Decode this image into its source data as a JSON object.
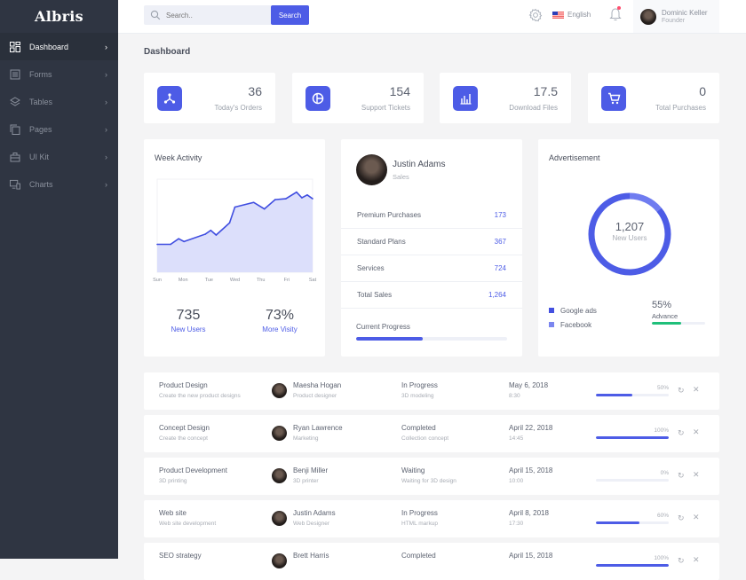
{
  "app": {
    "logo": "Albris"
  },
  "sidebar": {
    "items": [
      {
        "label": "Dashboard",
        "icon": "dashboard-grid-icon",
        "active": true
      },
      {
        "label": "Forms",
        "icon": "forms-icon"
      },
      {
        "label": "Tables",
        "icon": "layers-icon"
      },
      {
        "label": "Pages",
        "icon": "pages-copy-icon"
      },
      {
        "label": "UI Kit",
        "icon": "briefcase-icon"
      },
      {
        "label": "Charts",
        "icon": "monitor-chart-icon"
      }
    ]
  },
  "topbar": {
    "search_placeholder": "Search..",
    "search_button": "Search",
    "language": "English",
    "user": {
      "name": "Dominic Keller",
      "role": "Founder"
    }
  },
  "page": {
    "title": "Dashboard"
  },
  "stats": [
    {
      "value": "36",
      "label": "Today's Orders",
      "icon": "network-icon"
    },
    {
      "value": "154",
      "label": "Support Tickets",
      "icon": "pie-icon"
    },
    {
      "value": "17.5",
      "label": "Download Files",
      "icon": "bar-chart-icon"
    },
    {
      "value": "0",
      "label": "Total Purchases",
      "icon": "cart-icon"
    }
  ],
  "week_activity": {
    "title": "Week Activity",
    "new_users_value": "735",
    "new_users_label": "New Users",
    "visity_value": "73%",
    "visity_label": "More Visity"
  },
  "chart_data": {
    "type": "area",
    "title": "Week Activity",
    "categories": [
      "Sun",
      "Mon",
      "Tue",
      "Wed",
      "Thu",
      "Fri",
      "Sat"
    ],
    "x": [
      0,
      0.5,
      0.8,
      1.0,
      1.8,
      2.0,
      2.2,
      2.7,
      2.9,
      3.6,
      4.0,
      4.4,
      4.8,
      5.2,
      5.4,
      5.6,
      5.8
    ],
    "y": [
      30,
      30,
      36,
      33,
      41,
      45,
      40,
      53,
      70,
      75,
      68,
      78,
      79,
      86,
      80,
      83,
      79
    ],
    "ylim": [
      0,
      100
    ],
    "xlim": [
      0,
      5.8
    ],
    "color": "#3f4de0",
    "fill": "#dcdffb"
  },
  "profile": {
    "name": "Justin Adams",
    "role": "Sales",
    "rows": [
      {
        "label": "Premium Purchases",
        "value": "173"
      },
      {
        "label": "Standard Plans",
        "value": "367"
      },
      {
        "label": "Services",
        "value": "724"
      },
      {
        "label": "Total Sales",
        "value": "1,264"
      }
    ],
    "progress_label": "Current Progress",
    "progress": 0.44
  },
  "advertisement": {
    "title": "Advertisement",
    "center_value": "1,207",
    "center_label": "New Users",
    "donut": [
      {
        "name": "Google ads",
        "value": 86,
        "color": "#4d5ce6"
      },
      {
        "name": "Facebook",
        "value": 14,
        "color": "#6f7cf0"
      }
    ],
    "legend": [
      {
        "label": "Google ads",
        "color": "#4450e0"
      },
      {
        "label": "Facebook",
        "color": "#7b86ef"
      }
    ],
    "advance_value": "55%",
    "advance_label": "Advance",
    "advance_progress": 0.55,
    "advance_color": "#1fbf7a"
  },
  "tasks": [
    {
      "title": "Product Design",
      "desc": "Create the new product designs",
      "person": "Maesha Hogan",
      "person_role": "Product designer",
      "status": "In Progress",
      "status_desc": "3D modeling",
      "date": "May 6, 2018",
      "time": "8:30",
      "percent": "50%",
      "progress": 0.5
    },
    {
      "title": "Concept Design",
      "desc": "Create the concept",
      "person": "Ryan Lawrence",
      "person_role": "Marketing",
      "status": "Completed",
      "status_desc": "Collection concept",
      "date": "April 22, 2018",
      "time": "14:45",
      "percent": "100%",
      "progress": 1.0
    },
    {
      "title": "Product Development",
      "desc": "3D printing",
      "person": "Benji Miller",
      "person_role": "3D printer",
      "status": "Waiting",
      "status_desc": "Waiting for 3D design",
      "date": "April 15, 2018",
      "time": "10:00",
      "percent": "0%",
      "progress": 0
    },
    {
      "title": "Web site",
      "desc": "Web site development",
      "person": "Justin Adams",
      "person_role": "Web Designer",
      "status": "In Progress",
      "status_desc": "HTML markup",
      "date": "April 8, 2018",
      "time": "17:30",
      "percent": "60%",
      "progress": 0.6
    },
    {
      "title": "SEO strategy",
      "desc": "",
      "person": "Brett Harris",
      "person_role": "",
      "status": "Completed",
      "status_desc": "",
      "date": "April 15, 2018",
      "time": "",
      "percent": "100%",
      "progress": 1.0
    }
  ],
  "icons": {
    "refresh": "↻",
    "close": "✕",
    "chevron": "›"
  }
}
